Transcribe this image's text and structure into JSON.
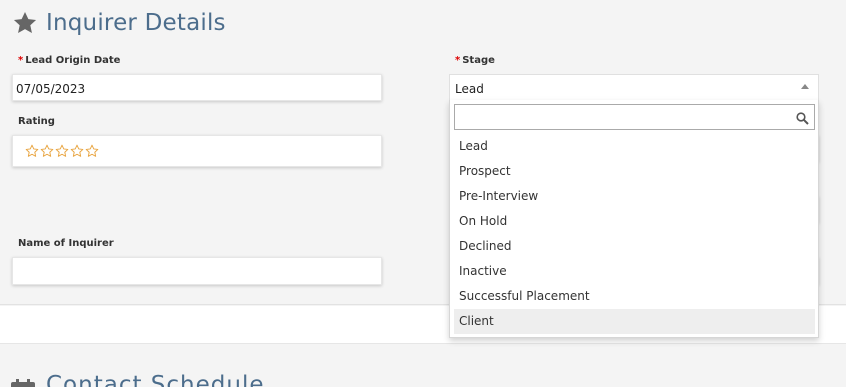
{
  "section": {
    "title": "Inquirer Details",
    "icon": "star-icon"
  },
  "fields": {
    "lead_origin_date": {
      "required_mark": "*",
      "label": "Lead Origin Date",
      "value": "07/05/2023"
    },
    "rating": {
      "label": "Rating",
      "stars_total": 5,
      "stars_filled": 0,
      "star_color": "#e8a33d"
    },
    "name_of_inquirer": {
      "label": "Name of Inquirer",
      "value": ""
    },
    "stage": {
      "required_mark": "*",
      "label": "Stage",
      "value": "Lead"
    }
  },
  "stage_dropdown": {
    "search_placeholder": "",
    "options": [
      {
        "label": "Lead"
      },
      {
        "label": "Prospect"
      },
      {
        "label": "Pre-Interview"
      },
      {
        "label": "On Hold"
      },
      {
        "label": "Declined"
      },
      {
        "label": "Inactive"
      },
      {
        "label": "Successful Placement"
      },
      {
        "label": "Client",
        "highlighted": true
      }
    ]
  },
  "next_section": {
    "title": "Contact Schedule",
    "icon": "calendar-icon"
  },
  "colors": {
    "title": "#4c6d8c",
    "required": "#dd0000",
    "highlight": "#eeeeee"
  }
}
